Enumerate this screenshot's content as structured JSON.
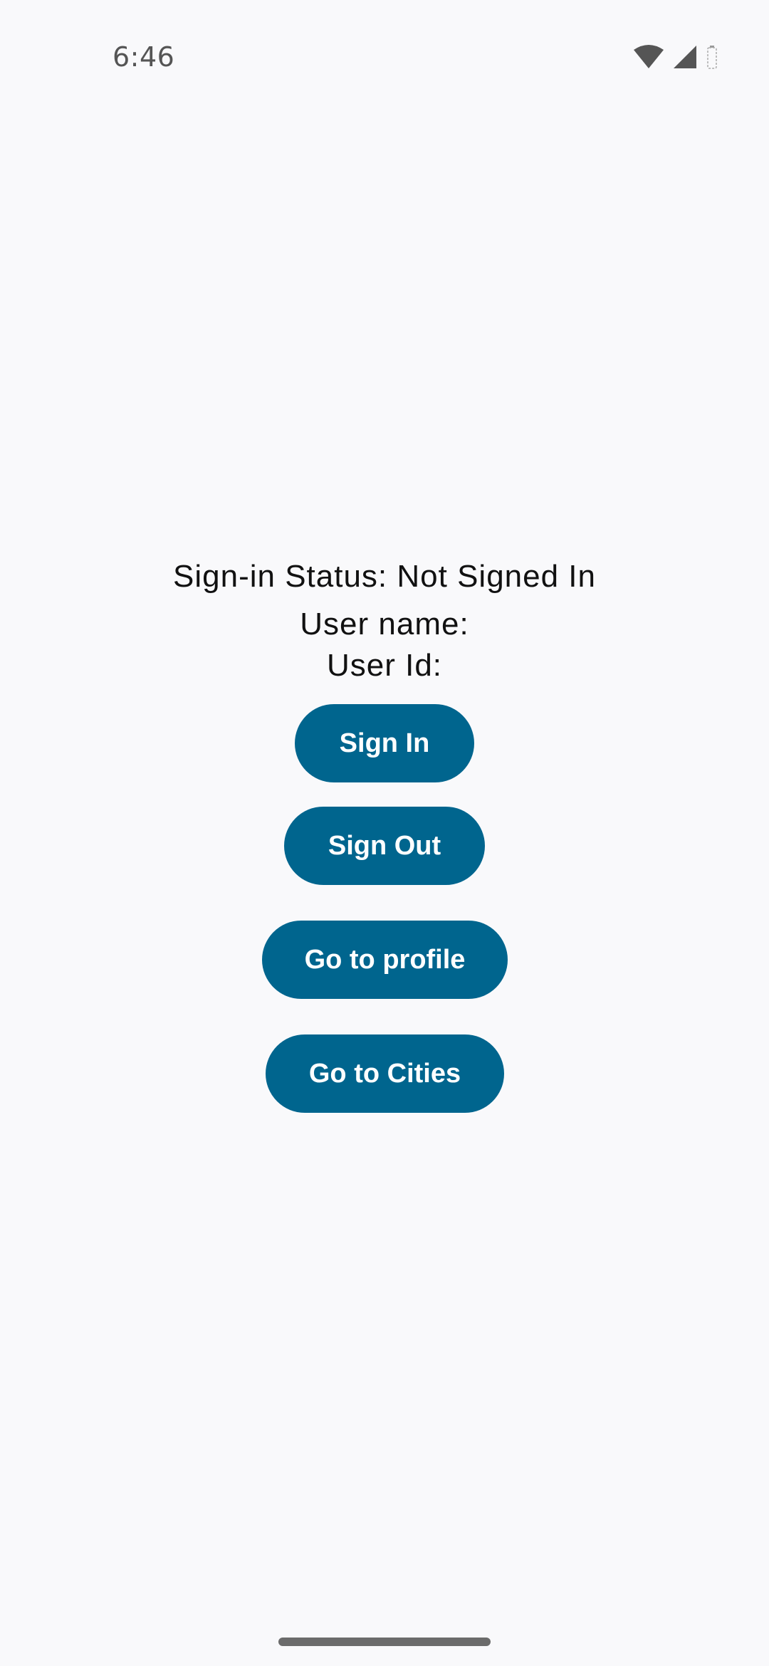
{
  "status_bar": {
    "time": "6:46",
    "icons": [
      "wifi-icon",
      "cellular-signal-icon",
      "battery-icon"
    ]
  },
  "auth": {
    "status_text": "Sign-in Status: Not Signed In",
    "user_name_label": "User name:",
    "user_id_label": "User Id:"
  },
  "buttons": {
    "sign_in": "Sign In",
    "sign_out": "Sign Out",
    "go_to_profile": "Go to profile",
    "go_to_cities": "Go to Cities"
  },
  "colors": {
    "background": "#f9f9fb",
    "button": "#00658e",
    "button_text": "#ffffff"
  }
}
